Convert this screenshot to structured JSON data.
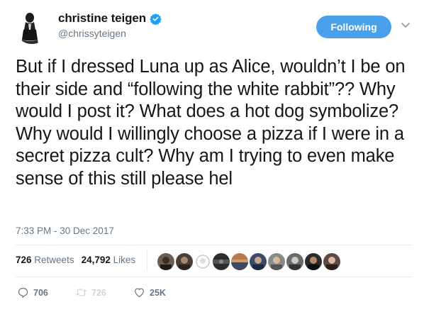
{
  "user": {
    "display_name": "christine teigen",
    "handle": "@chrissyteigen",
    "verified": true,
    "follow_button": "Following"
  },
  "tweet": {
    "text": "But if I dressed Luna up as Alice, wouldn’t I be on their side and “following the white rabbit”?? Why would I post it? What does a hot dog symbolize? Why would I willingly choose a pizza if I were in a secret pizza cult? Why am I trying to even make sense of this still please hel",
    "timestamp": "7:33 PM - 30 Dec 2017"
  },
  "stats": {
    "retweets_count": "726",
    "retweets_label": "Retweets",
    "likes_count": "24,792",
    "likes_label": "Likes"
  },
  "actions": {
    "reply_count": "706",
    "retweet_count": "726",
    "like_count": "25K"
  },
  "colors": {
    "accent": "#4aa1eb",
    "verified": "#1da1f2",
    "muted": "#657786"
  }
}
